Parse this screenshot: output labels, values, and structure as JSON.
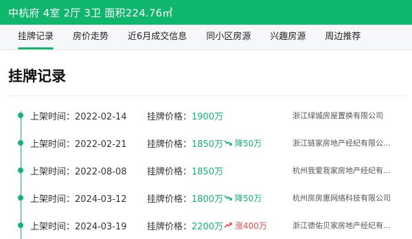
{
  "header": {
    "title": "中杭府 4室 2厅 3卫 面积224.76㎡"
  },
  "tabs": [
    {
      "label": "挂牌记录",
      "active": true
    },
    {
      "label": "房价走势",
      "active": false
    },
    {
      "label": "近6月成交信息",
      "active": false
    },
    {
      "label": "同小区房源",
      "active": false
    },
    {
      "label": "兴趣房源",
      "active": false
    },
    {
      "label": "周边推荐",
      "active": false
    }
  ],
  "section": {
    "title": "挂牌记录",
    "date_label": "上架时间：",
    "price_label": "挂牌价格："
  },
  "records": [
    {
      "date": "2022-02-14",
      "price": "1900万",
      "change": "",
      "direction": "",
      "agent": "浙江绿城房屋置换有限公司"
    },
    {
      "date": "2022-02-21",
      "price": "1850万",
      "change": "降50万",
      "direction": "down",
      "agent": "浙江链家房地产经纪有限公..."
    },
    {
      "date": "2022-08-08",
      "price": "1850万",
      "change": "",
      "direction": "",
      "agent": "杭州我爱我家房地产经纪有..."
    },
    {
      "date": "2024-03-12",
      "price": "1800万",
      "change": "降50万",
      "direction": "down",
      "agent": "杭州房房惠网络科技有限公司"
    },
    {
      "date": "2024-03-19",
      "price": "2200万",
      "change": "涨400万",
      "direction": "up",
      "agent": "浙江德佑贝家房地产经纪有..."
    }
  ],
  "colors": {
    "accent": "#0fb76c",
    "up": "#f04b4b",
    "down": "#0fb76c"
  }
}
